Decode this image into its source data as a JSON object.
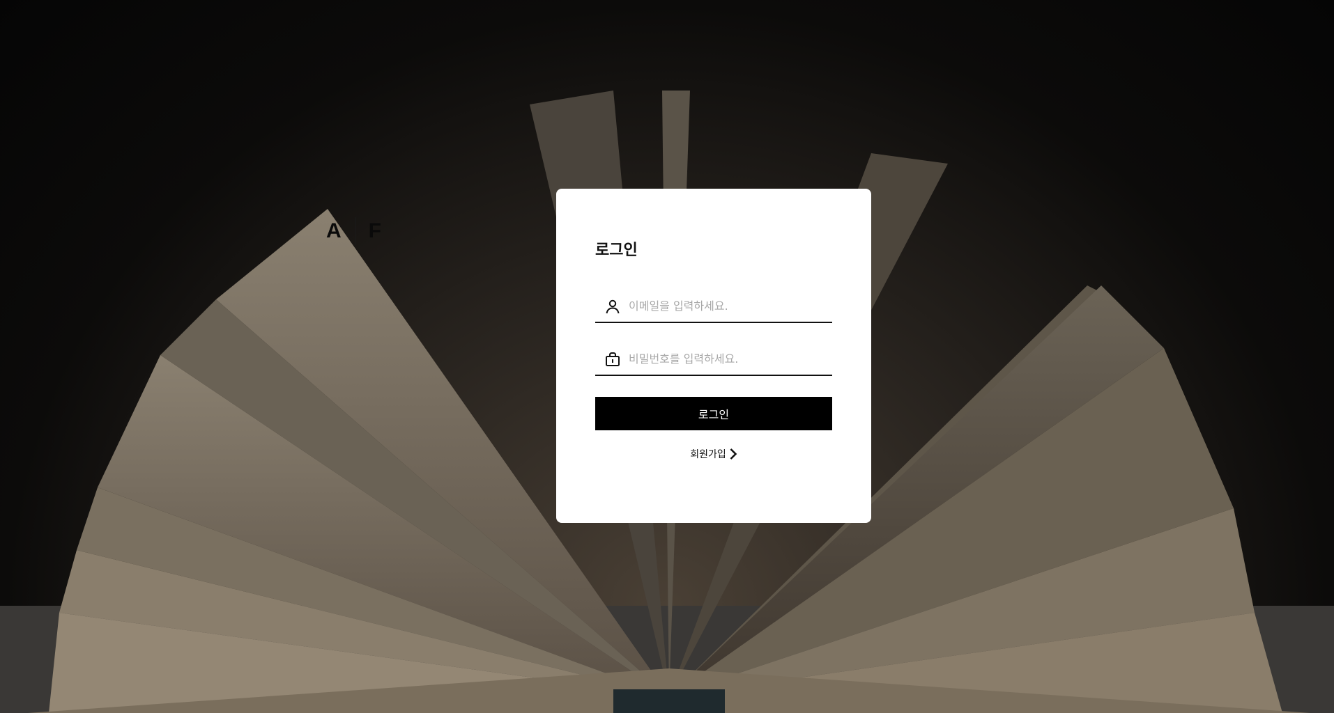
{
  "background": {
    "description_icon": "open-book-photo"
  },
  "brand": {
    "letter_left": "A",
    "letter_right": "F"
  },
  "login_card": {
    "title": "로그인",
    "email": {
      "icon": "user-icon",
      "placeholder": "이메일을 입력하세요.",
      "value": ""
    },
    "password": {
      "icon": "lock-icon",
      "placeholder": "비밀번호를 입력하세요.",
      "value": ""
    },
    "login_button_label": "로그인",
    "signup_link_label": "회원가입",
    "signup_icon": "chevron-right-icon"
  },
  "colors": {
    "button_bg": "#000000",
    "card_bg": "#ffffff",
    "placeholder": "#a8a8a8"
  }
}
